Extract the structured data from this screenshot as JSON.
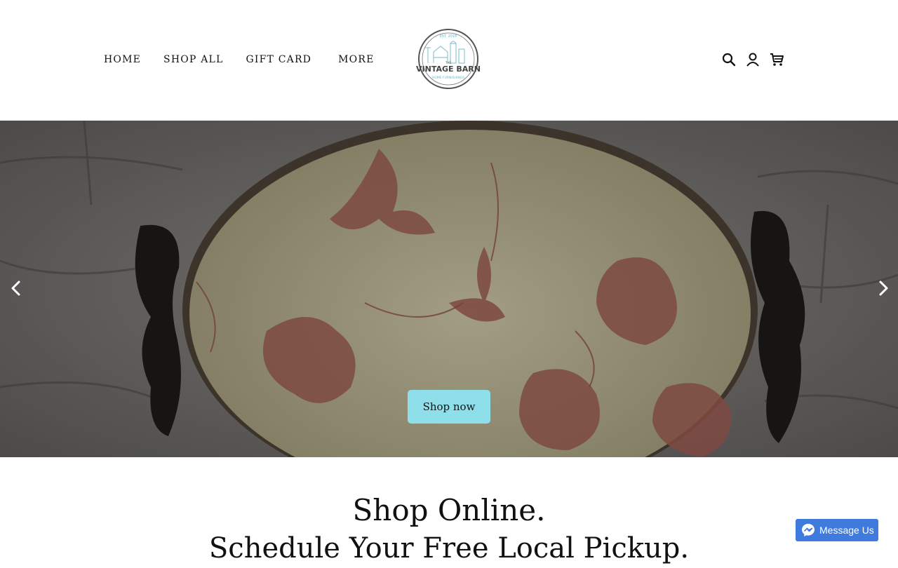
{
  "nav": {
    "items": [
      "HOME",
      "SHOP ALL",
      "GIFT CARD",
      "MORE"
    ]
  },
  "logo": {
    "top_text": "EST. 2018",
    "small_text": "THE",
    "name": "VINTAGE BARN",
    "sub_text": "HOME FURNISHINGS"
  },
  "header_icons": [
    "search-icon",
    "account-icon",
    "cart-icon"
  ],
  "hero": {
    "button_label": "Shop now",
    "colors": {
      "button": "#8fdfeb"
    }
  },
  "tagline": {
    "line1": "Shop Online.",
    "line2": "Schedule Your Free Local Pickup."
  },
  "messenger": {
    "label": "Message Us",
    "color": "#3f7bdd"
  }
}
